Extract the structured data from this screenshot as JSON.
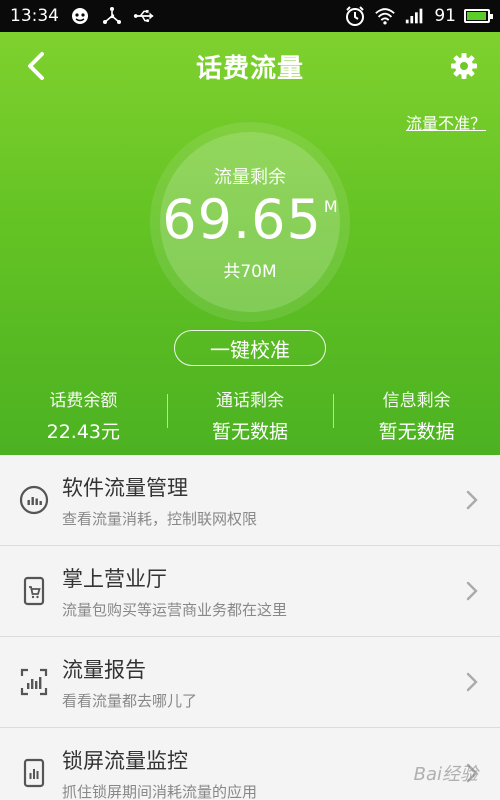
{
  "status_bar": {
    "time": "13:34",
    "battery_percent": "91",
    "icons": [
      "wechat-icon",
      "usb-share-icon",
      "usb-icon",
      "alarm-icon",
      "wifi-icon",
      "signal-icon",
      "battery-icon"
    ]
  },
  "header": {
    "title": "话费流量",
    "inaccurate_link": "流量不准？"
  },
  "gauge": {
    "label": "流量剩余",
    "value": "69.65",
    "unit": "M",
    "total": "共70M"
  },
  "calibrate_button": "一键校准",
  "stats": [
    {
      "label": "话费余额",
      "value": "22.43元"
    },
    {
      "label": "通话剩余",
      "value": "暂无数据"
    },
    {
      "label": "信息剩余",
      "value": "暂无数据"
    }
  ],
  "list": [
    {
      "title": "软件流量管理",
      "subtitle": "查看流量消耗，控制联网权限",
      "icon": "app-traffic-icon"
    },
    {
      "title": "掌上营业厅",
      "subtitle": "流量包购买等运营商业务都在这里",
      "icon": "mobile-store-icon"
    },
    {
      "title": "流量报告",
      "subtitle": "看看流量都去哪儿了",
      "icon": "report-icon"
    },
    {
      "title": "锁屏流量监控",
      "subtitle": "抓住锁屏期间消耗流量的应用",
      "icon": "lockscreen-monitor-icon"
    }
  ],
  "watermark": "Bai经验",
  "colors": {
    "header_green_top": "#7fd12e",
    "header_green_bottom": "#4cb222",
    "list_bg": "#f4f4f4"
  }
}
